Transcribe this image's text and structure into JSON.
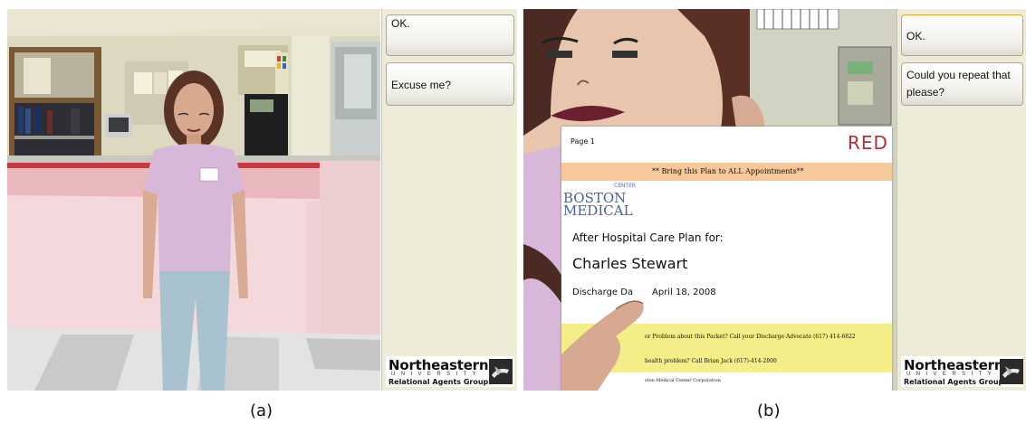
{
  "panel_a": {
    "options": [
      "OK.",
      "Excuse me?"
    ],
    "logo": {
      "line1": "Northeastern",
      "line2": "UNIVERSITY",
      "line3": "Relational Agents Group"
    },
    "caption": "(a)"
  },
  "panel_b": {
    "options": [
      "OK.",
      "Could you repeat that please?"
    ],
    "logo": {
      "line1": "Northeastern",
      "line2": "UNIVERSITY",
      "line3": "Relational Agents Group"
    },
    "caption": "(b)",
    "document": {
      "page": "Page 1",
      "red_logo": "RED",
      "banner": "** Bring this Plan to ALL Appointments**",
      "hospital_line1": "BOSTON",
      "hospital_line2": "MEDICAL",
      "hospital_tag": "CENTER",
      "heading": "After Hospital Care Plan for:",
      "patient": "Charles Stewart",
      "discharge_label": "Discharge Da",
      "discharge_date": "April 18, 2008",
      "footer_line1": "or Problem about this Packet? Call your Discharge Advocate (617) 414-6822",
      "footer_line2": "health problem? Call Brian Jack (617)-414-2800",
      "footer_line3": "ston Medical Center Corporation"
    }
  }
}
